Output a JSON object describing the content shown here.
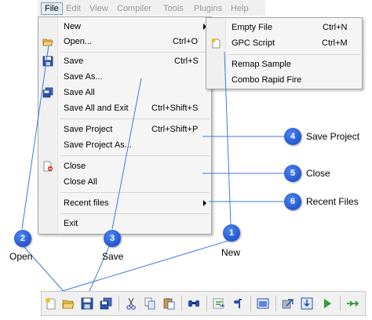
{
  "menubar": {
    "items": [
      "File",
      "Edit",
      "View",
      "Compiler",
      "Tools",
      "Plugins",
      "Help"
    ]
  },
  "file_menu": {
    "items": [
      {
        "label": "New",
        "shortcut": "",
        "submenu": true
      },
      {
        "label": "Open...",
        "shortcut": "Ctrl+O"
      },
      {
        "label": "Save",
        "shortcut": "Ctrl+S"
      },
      {
        "label": "Save As...",
        "shortcut": ""
      },
      {
        "label": "Save All",
        "shortcut": ""
      },
      {
        "label": "Save All and Exit",
        "shortcut": "Ctrl+Shift+S"
      },
      {
        "label": "Save Project",
        "shortcut": "Ctrl+Shift+P"
      },
      {
        "label": "Save Project As...",
        "shortcut": ""
      },
      {
        "label": "Close",
        "shortcut": ""
      },
      {
        "label": "Close All",
        "shortcut": ""
      },
      {
        "label": "Recent files",
        "shortcut": "",
        "submenu": true
      },
      {
        "label": "Exit",
        "shortcut": ""
      }
    ]
  },
  "new_submenu": {
    "items": [
      {
        "label": "Empty File",
        "shortcut": "Ctrl+N"
      },
      {
        "label": "GPC Script",
        "shortcut": "Ctrl+M"
      },
      {
        "label": "Remap Sample",
        "shortcut": ""
      },
      {
        "label": "Combo Rapid Fire",
        "shortcut": ""
      }
    ]
  },
  "callouts": [
    {
      "number": "1",
      "label": "New"
    },
    {
      "number": "2",
      "label": "Open"
    },
    {
      "number": "3",
      "label": "Save"
    },
    {
      "number": "4",
      "label": "Save Project"
    },
    {
      "number": "5",
      "label": "Close"
    },
    {
      "number": "6",
      "label": "Recent Files"
    }
  ],
  "toolbar": {
    "icons": [
      "new-file-icon",
      "open-folder-icon",
      "save-icon",
      "save-all-icon",
      "cut-icon",
      "copy-icon",
      "paste-icon",
      "find-icon",
      "replace-icon",
      "format-icon",
      "window-icon",
      "export-icon",
      "download-icon",
      "run-icon",
      "forward-icon"
    ]
  },
  "colors": {
    "callout": "#1f55d6",
    "callout_line": "#3d7be0",
    "menu_bg": "#f5f5f5",
    "toolbar_bg": "#f0f0f0"
  }
}
